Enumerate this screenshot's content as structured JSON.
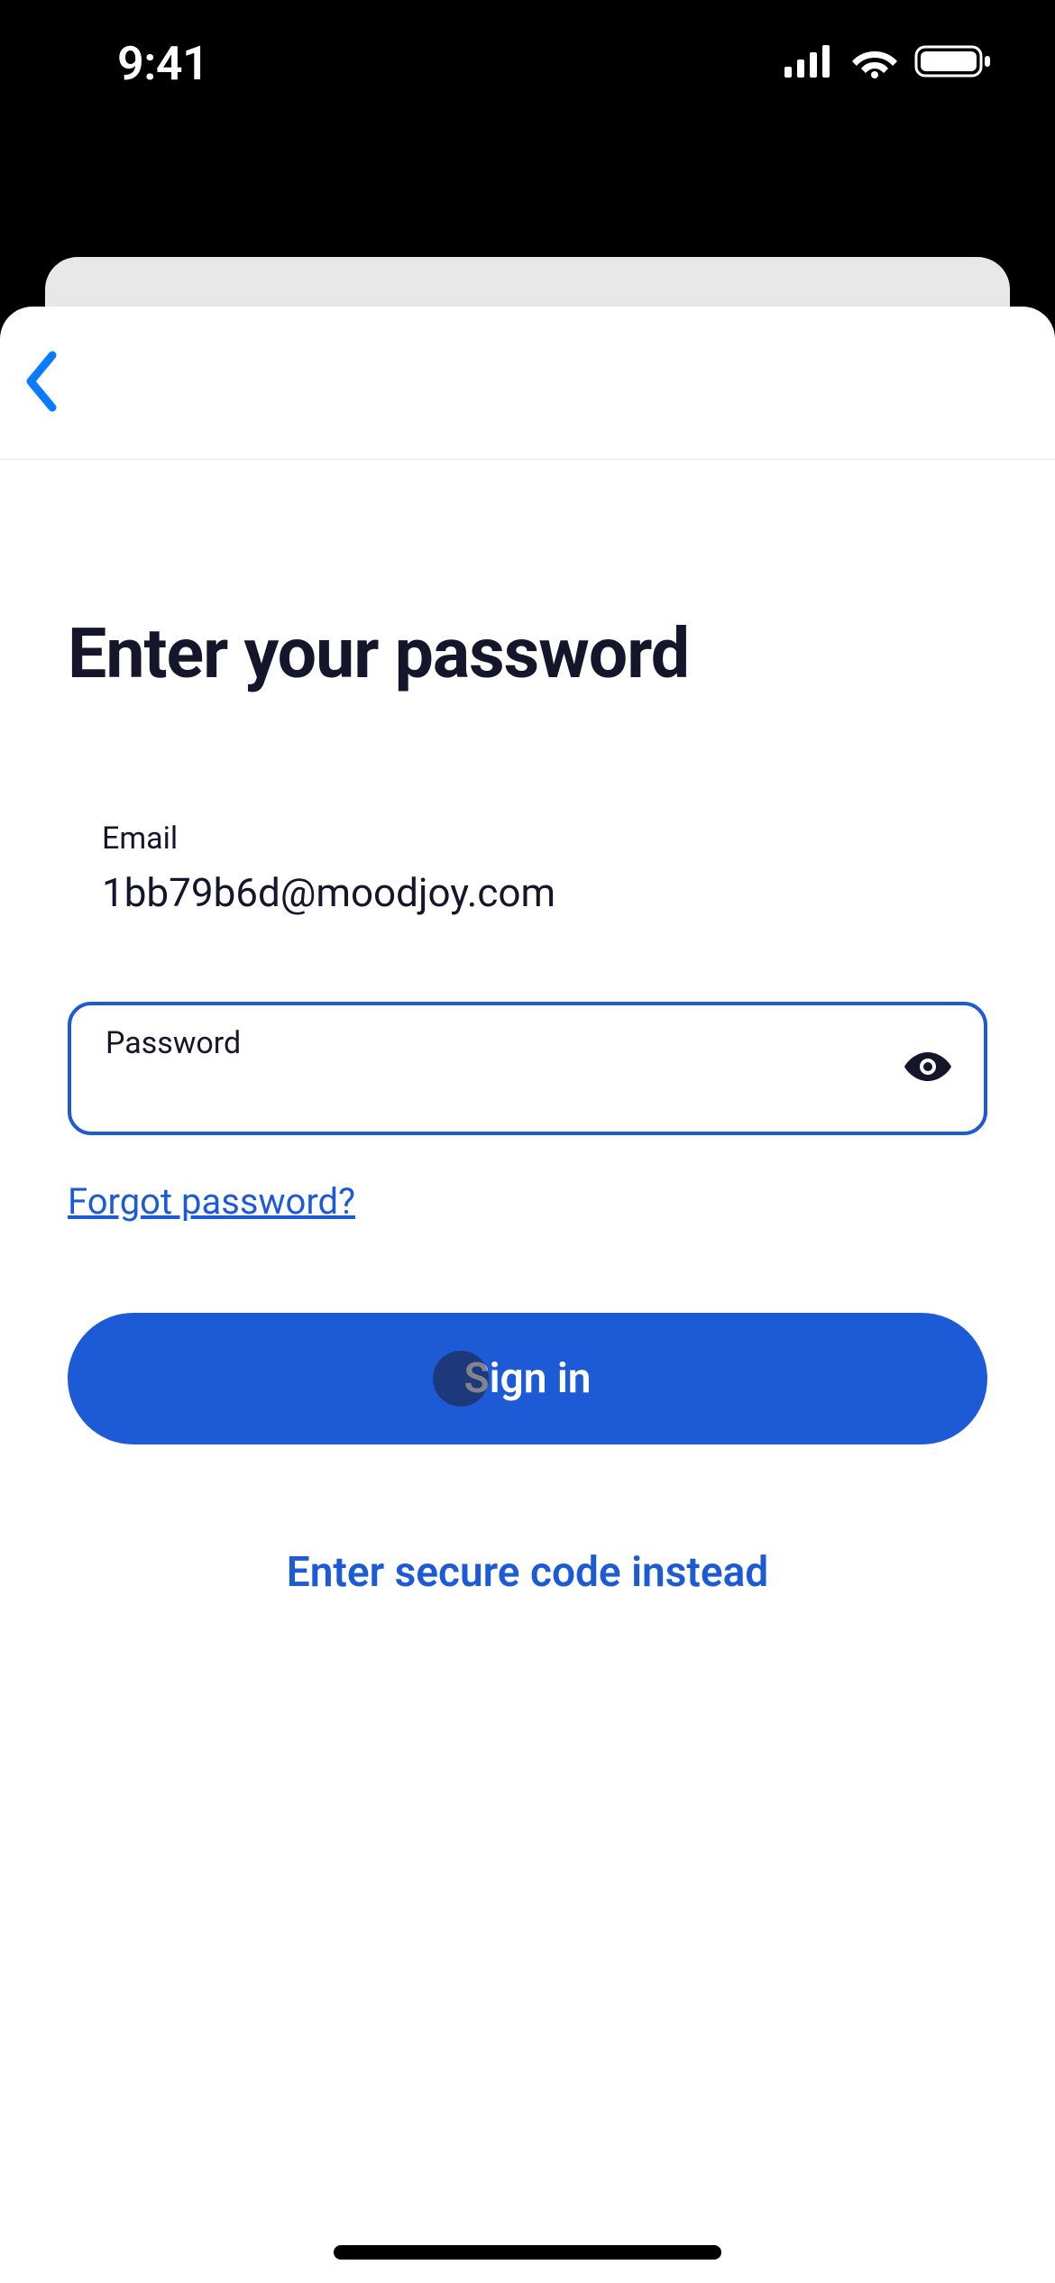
{
  "status": {
    "time": "9:41"
  },
  "page": {
    "title": "Enter your password",
    "email_label": "Email",
    "email_value": "1bb79b6d@moodjoy.com",
    "password_label": "Password",
    "password_value": "",
    "forgot_label": "Forgot password?",
    "signin_label": "Sign in",
    "secure_code_label": "Enter secure code instead"
  },
  "colors": {
    "accent": "#1d5bd6",
    "text_primary": "#15162b"
  }
}
